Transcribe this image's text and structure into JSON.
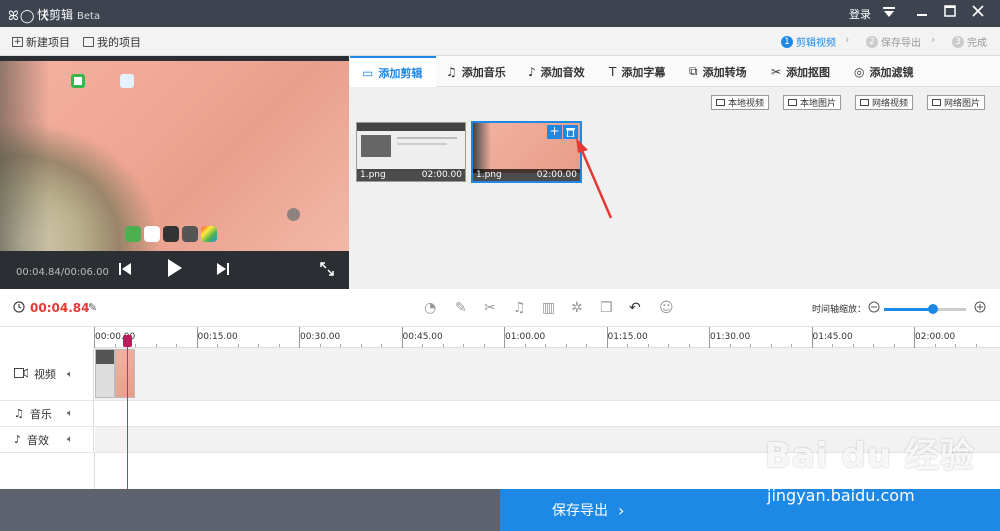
{
  "titlebar": {
    "logo": "ꕤ◯〈",
    "app_name": "快剪辑",
    "edition": "Beta",
    "login": "登录",
    "dropdown_icon": "menu-down-icon",
    "min_icon": "minimize-icon",
    "max_icon": "maximize-icon",
    "close_icon": "close-icon"
  },
  "toolbar": {
    "new_project": "新建项目",
    "my_projects": "我的项目",
    "steps": [
      {
        "num": "1",
        "label": "剪辑视频"
      },
      {
        "num": "2",
        "label": "保存导出"
      },
      {
        "num": "3",
        "label": "完成"
      }
    ]
  },
  "preview": {
    "timecode": "00:04.84/00:06.00"
  },
  "tabs": [
    {
      "icon": "▭",
      "label": "添加剪辑"
    },
    {
      "icon": "♫",
      "label": "添加音乐"
    },
    {
      "icon": "♪",
      "label": "添加音效"
    },
    {
      "icon": "T",
      "label": "添加字幕"
    },
    {
      "icon": "⧉",
      "label": "添加转场"
    },
    {
      "icon": "✂",
      "label": "添加抠图"
    },
    {
      "icon": "◎",
      "label": "添加滤镜"
    }
  ],
  "sources": [
    {
      "label": "本地视频"
    },
    {
      "label": "本地图片"
    },
    {
      "label": "网络视频"
    },
    {
      "label": "网络图片"
    }
  ],
  "clips": [
    {
      "name": "1.png",
      "duration": "02:00.00"
    },
    {
      "name": "1.png",
      "duration": "02:00.00"
    }
  ],
  "timeline_toolbar": {
    "current_time": "00:04.84",
    "zoom_label": "时间轴缩放：",
    "zoom_level": 0.6
  },
  "ruler": [
    "00:00.00",
    "00:15.00",
    "00:30.00",
    "00:45.00",
    "01:00.00",
    "01:15.00",
    "01:30.00",
    "01:45.00",
    "02:00.00"
  ],
  "tracks": [
    {
      "label": "视频",
      "icon": "video-icon"
    },
    {
      "label": "音乐",
      "icon": "music-icon"
    },
    {
      "label": "音效",
      "icon": "sound-effect-icon"
    }
  ],
  "bottom": {
    "save_label": "保存导出",
    "arrow": "›"
  },
  "watermark": {
    "brand": "Bai du 经验",
    "url": "jingyan.baidu.com"
  }
}
